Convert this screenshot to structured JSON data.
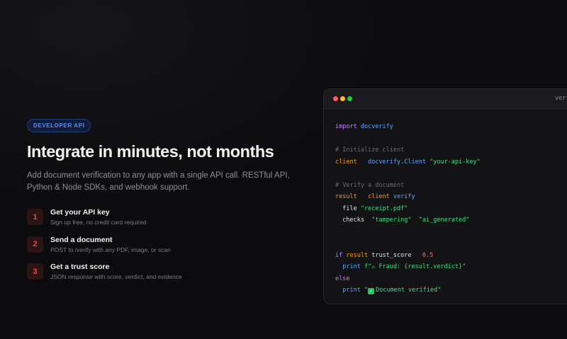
{
  "hero": {
    "badge": "DEVELOPER API",
    "title": "Integrate in minutes, not months",
    "subtitle": "Add document verification to any app with a single API call. RESTful API, Python & Node SDKs, and webhook support."
  },
  "steps": [
    {
      "num": "1",
      "title": "Get your API key",
      "desc": "Sign up free, no credit card required"
    },
    {
      "num": "2",
      "title": "Send a document",
      "desc": "POST to /verify with any PDF, image, or scan"
    },
    {
      "num": "3",
      "title": "Get a trust score",
      "desc": "JSON response with score, verdict, and evidence"
    }
  ],
  "code_window": {
    "filename": "verify.py",
    "lines": {
      "l1_kw": "import",
      "l1_mod": "docverify",
      "l3_comment": "# Initialize client",
      "l4_var": "client",
      "l4_ctor": "docverify.Client",
      "l4_str": "\"your-api-key\"",
      "l6_comment": "# Verify a document",
      "l7_var": "result",
      "l7_obj": "client",
      "l7_fn": "verify",
      "l8_key": "file",
      "l8_str": "\"receipt.pdf\"",
      "l9_key": "checks",
      "l9_str1": "\"tampering\"",
      "l9_str2": "\"ai_generated\"",
      "l12_kw": "if",
      "l12_var": "result",
      "l12_prop": "trust_score",
      "l12_num": "0.5",
      "l13_fn": "print",
      "l13_str": "f\"⚠ Fraud: {result.verdict}\"",
      "l14_kw": "else",
      "l15_fn": "print",
      "l15_str_open": "\"",
      "l15_check": "✓",
      "l15_str": "Document verified\""
    }
  },
  "colors": {
    "accent_red": "#ef4444",
    "badge_blue": "#5b8ef0",
    "code_keyword": "#c084fc",
    "code_string": "#4ade80",
    "code_variable": "#f59e0b"
  }
}
